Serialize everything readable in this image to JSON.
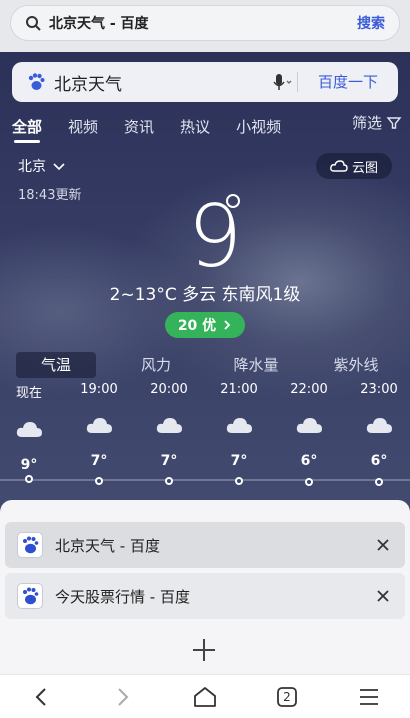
{
  "address_bar": {
    "text": "北京天气 - 百度",
    "search_label": "搜索"
  },
  "search": {
    "query": "北京天气",
    "button_label": "百度一下"
  },
  "tabs": [
    {
      "label": "全部",
      "active": true
    },
    {
      "label": "视频"
    },
    {
      "label": "资讯"
    },
    {
      "label": "热议"
    },
    {
      "label": "小视频"
    }
  ],
  "filter_label": "筛选",
  "weather": {
    "city": "北京",
    "cloud_map_label": "云图",
    "updated": "18:43更新",
    "current_temp": "9",
    "summary": "2~13°C 多云 东南风1级",
    "aqi": "20 优",
    "subtabs": [
      "气温",
      "风力",
      "降水量",
      "紫外线"
    ],
    "hourly": [
      {
        "time": "现在",
        "temp": "9°"
      },
      {
        "time": "19:00",
        "temp": "7°"
      },
      {
        "time": "20:00",
        "temp": "7°"
      },
      {
        "time": "21:00",
        "temp": "7°"
      },
      {
        "time": "22:00",
        "temp": "6°"
      },
      {
        "time": "23:00",
        "temp": "6°"
      }
    ]
  },
  "open_tabs": [
    {
      "title": "北京天气 - 百度"
    },
    {
      "title": "今天股票行情 - 百度"
    }
  ],
  "bottom_nav": {
    "tab_count": "2"
  },
  "colors": {
    "accent": "#3a5bd9",
    "aqi_green": "#35b35b"
  }
}
